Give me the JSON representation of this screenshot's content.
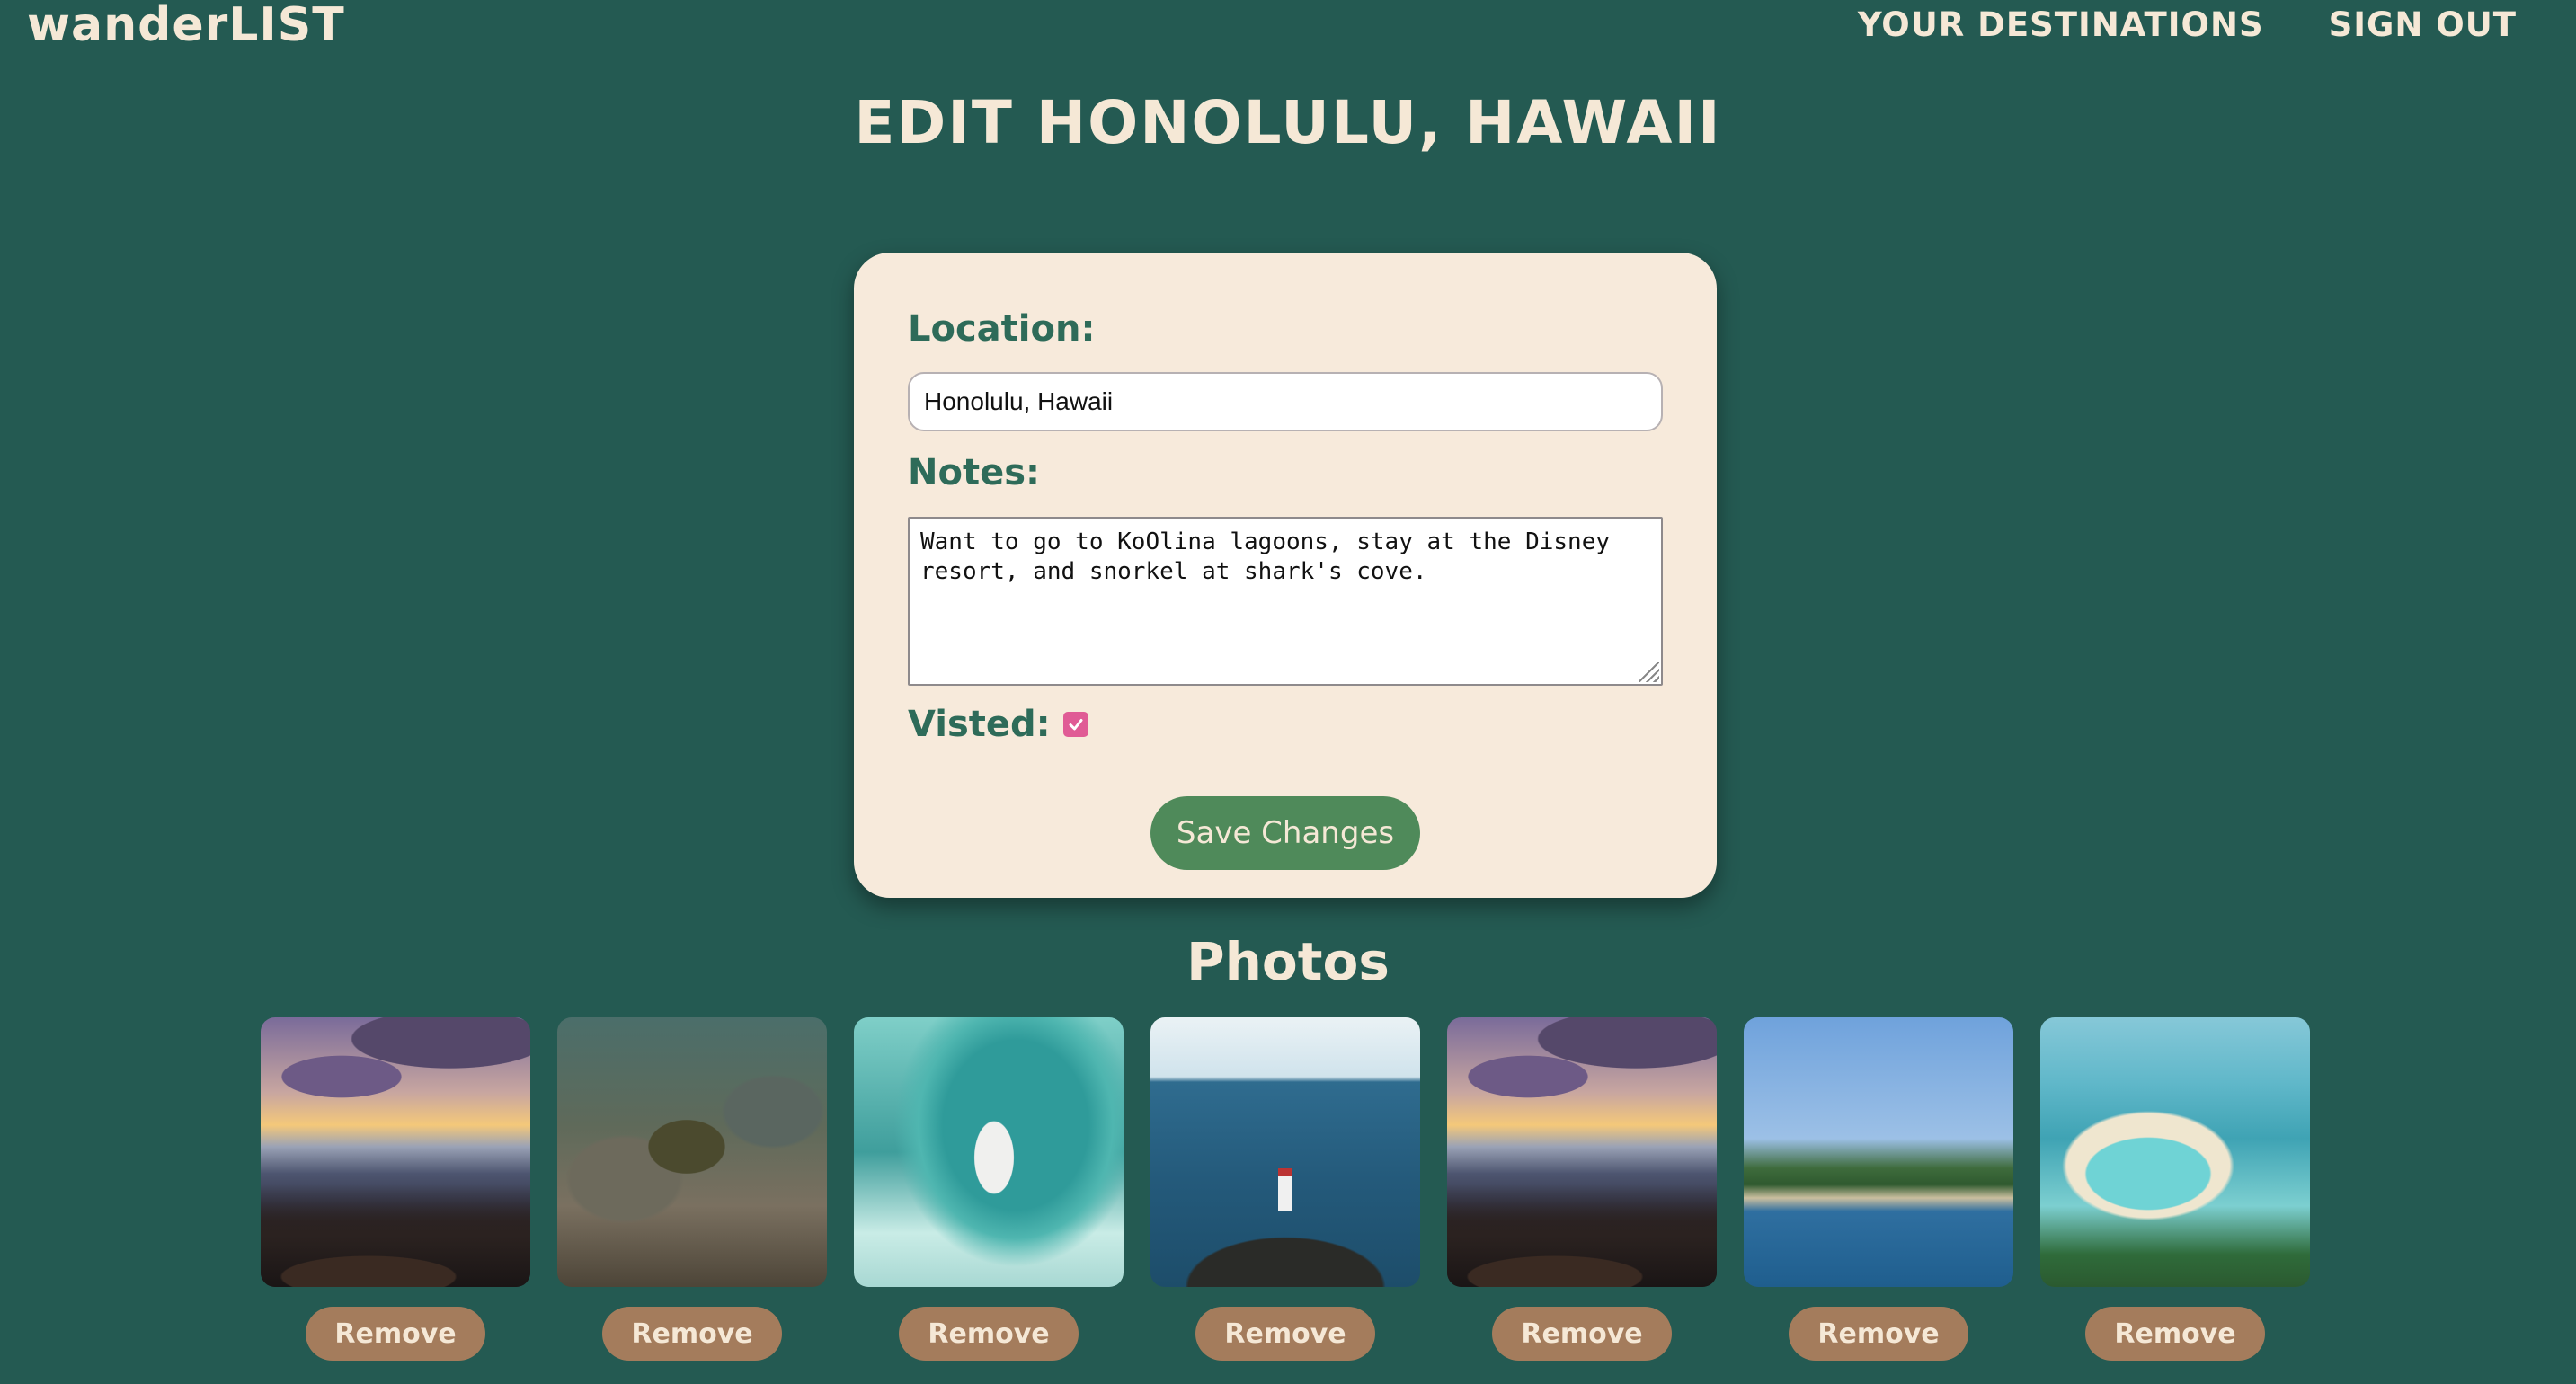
{
  "header": {
    "brand": "wanderLIST",
    "nav": [
      "your destinations",
      "sign out"
    ]
  },
  "page_title": "EDIT HONOLULU, HAWAII",
  "form": {
    "location_label": "Location:",
    "location_value": "Honolulu, Hawaii",
    "notes_label": "Notes:",
    "notes_value": "Want to go to KoOlina lagoons, stay at the Disney resort, and snorkel at shark's cove.",
    "visited_label": "Visted:",
    "visited_checked": true,
    "save_label": "Save Changes"
  },
  "photos": {
    "title": "Photos",
    "remove_label": "Remove",
    "items": [
      {
        "scene": "sunset over rocky shore"
      },
      {
        "scene": "sea turtle underwater"
      },
      {
        "scene": "surfer in wave barrel"
      },
      {
        "scene": "lighthouse over ocean"
      },
      {
        "scene": "sunset over rocky shore"
      },
      {
        "scene": "beach resort bay"
      },
      {
        "scene": "lagoon beach aerial"
      }
    ]
  },
  "colors": {
    "background": "#245a52",
    "card": "#f7eadb",
    "label": "#2e6b59",
    "save_button": "#4f8a5a",
    "remove_button": "#a47c5c",
    "checkbox": "#e05b95",
    "light_text": "#f5e8d6"
  }
}
